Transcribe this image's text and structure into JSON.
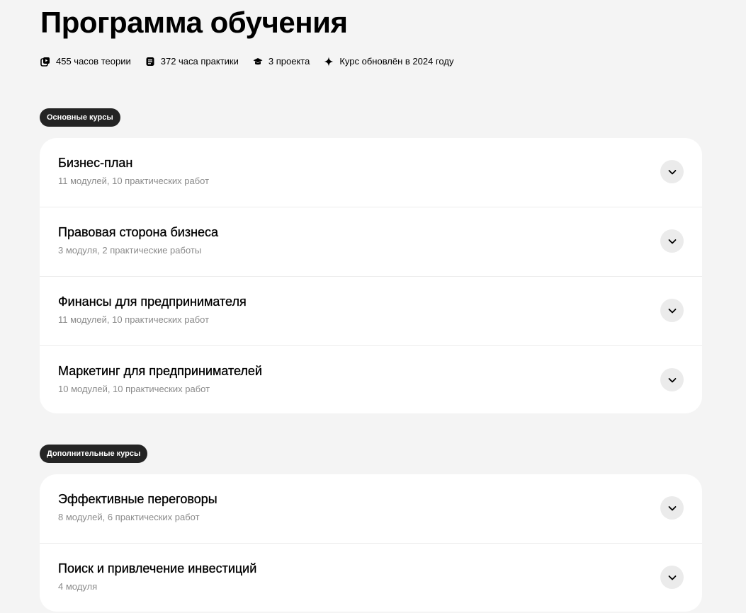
{
  "page_title": "Программа обучения",
  "stats": [
    {
      "icon": "theory-icon",
      "label": "455 часов теории"
    },
    {
      "icon": "practice-icon",
      "label": "372 часа практики"
    },
    {
      "icon": "graduation-cap-icon",
      "label": "3 проекта"
    },
    {
      "icon": "sparkle-icon",
      "label": "Курс обновлён в 2024 году"
    }
  ],
  "sections": [
    {
      "badge": "Основные курсы",
      "courses": [
        {
          "name": "Бизнес-план",
          "meta": "11 модулей, 10 практических работ"
        },
        {
          "name": "Правовая сторона бизнеса",
          "meta": "3 модуля, 2 практические работы"
        },
        {
          "name": "Финансы для предпринимателя",
          "meta": "11 модулей, 10 практических работ"
        },
        {
          "name": "Маркетинг для предпринимателей",
          "meta": "10 модулей, 10 практических работ"
        }
      ]
    },
    {
      "badge": "Дополнительные курсы",
      "courses": [
        {
          "name": "Эффективные переговоры",
          "meta": "8 модулей, 6 практических работ"
        },
        {
          "name": "Поиск и привлечение инвестиций",
          "meta": "4 модуля"
        }
      ]
    }
  ],
  "colors": {
    "background": "#f4f4f4",
    "card": "#ffffff",
    "badge": "#242424",
    "meta_text": "#8a8a8a",
    "chevron_bg": "#ebebeb"
  }
}
